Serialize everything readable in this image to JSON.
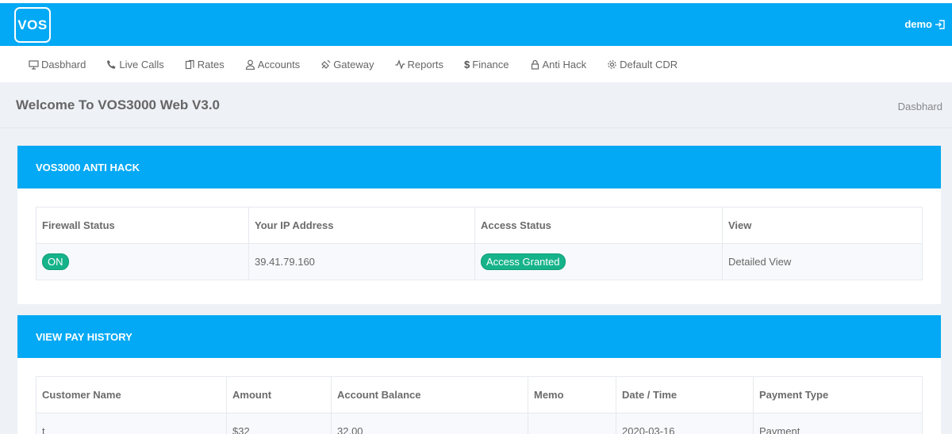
{
  "topbar": {
    "logo": "VOS",
    "user": "demo",
    "accent": "#03a9f4"
  },
  "nav": [
    {
      "label": "Dasbhard",
      "icon": "monitor-icon"
    },
    {
      "label": "Live Calls",
      "icon": "phone-icon"
    },
    {
      "label": "Rates",
      "icon": "rates-icon"
    },
    {
      "label": "Accounts",
      "icon": "user-icon"
    },
    {
      "label": "Gateway",
      "icon": "gateway-icon"
    },
    {
      "label": "Reports",
      "icon": "pulse-icon"
    },
    {
      "label": "Finance",
      "icon": "dollar-icon"
    },
    {
      "label": "Anti Hack",
      "icon": "lock-icon"
    },
    {
      "label": "Default CDR",
      "icon": "gear-icon"
    }
  ],
  "page": {
    "title": "Welcome To VOS3000 Web V3.0",
    "breadcrumb": "Dasbhard"
  },
  "antihack": {
    "title": "VOS3000 ANTI HACK",
    "headers": [
      "Firewall Status",
      "Your IP Address",
      "Access Status",
      "View"
    ],
    "firewall": "ON",
    "ip": "39.41.79.160",
    "access": "Access Granted",
    "view": "Detailed View"
  },
  "payhistory": {
    "title": "VIEW PAY HISTORY",
    "headers": [
      "Customer Name",
      "Amount",
      "Account Balance",
      "Memo",
      "Date / Time",
      "Payment Type"
    ],
    "row": [
      "t",
      "$32",
      "32.00",
      "",
      "2020-03-16",
      "Payment"
    ]
  }
}
